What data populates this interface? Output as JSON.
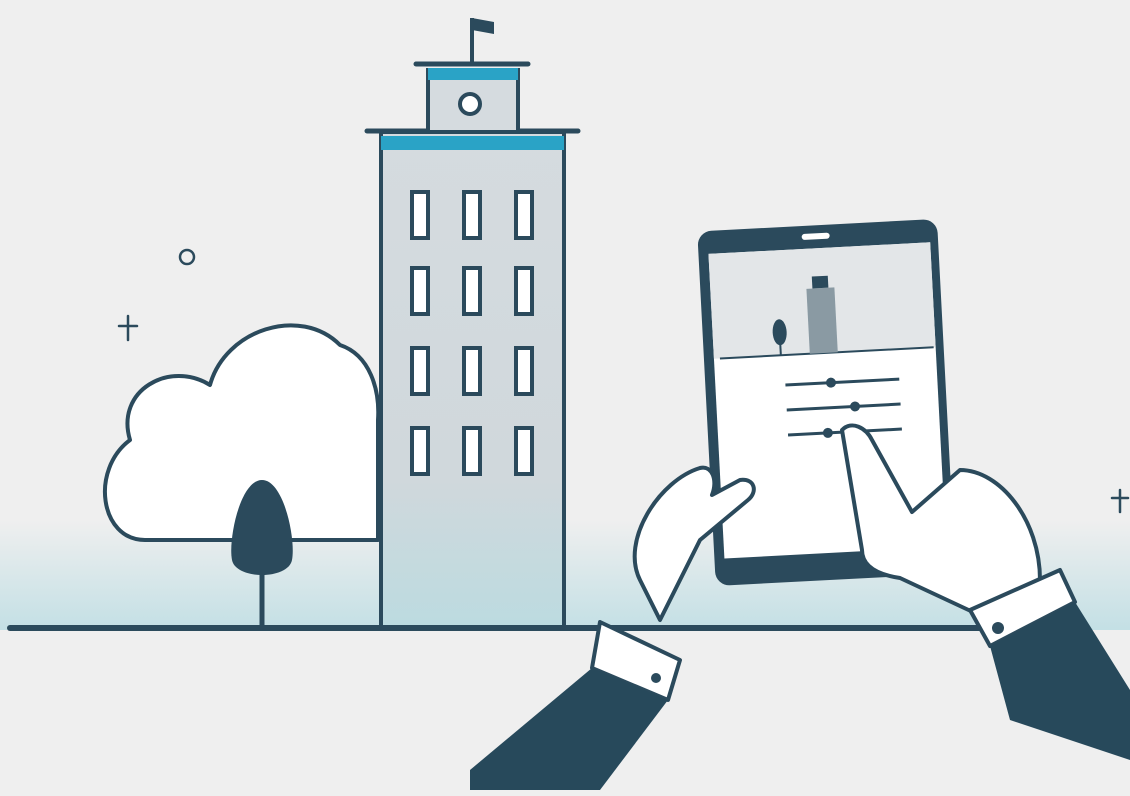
{
  "illustration": {
    "subject": "smart-building-control",
    "colors": {
      "background": "#efefef",
      "outline": "#2b4a5c",
      "accent": "#2aa3c6",
      "building_fill": "#d3d9dd",
      "ground_glow": "#bcdde3",
      "cloud_fill": "#ffffff",
      "sleeve": "#27495b",
      "cuff": "#ffffff"
    },
    "icons": [
      "building-icon",
      "flag-icon",
      "cloud-icon",
      "tree-icon",
      "tablet-icon",
      "slider-icon",
      "hand-icon",
      "sparkle-icon"
    ],
    "tablet_sliders": [
      0.4,
      0.6,
      0.35
    ]
  }
}
